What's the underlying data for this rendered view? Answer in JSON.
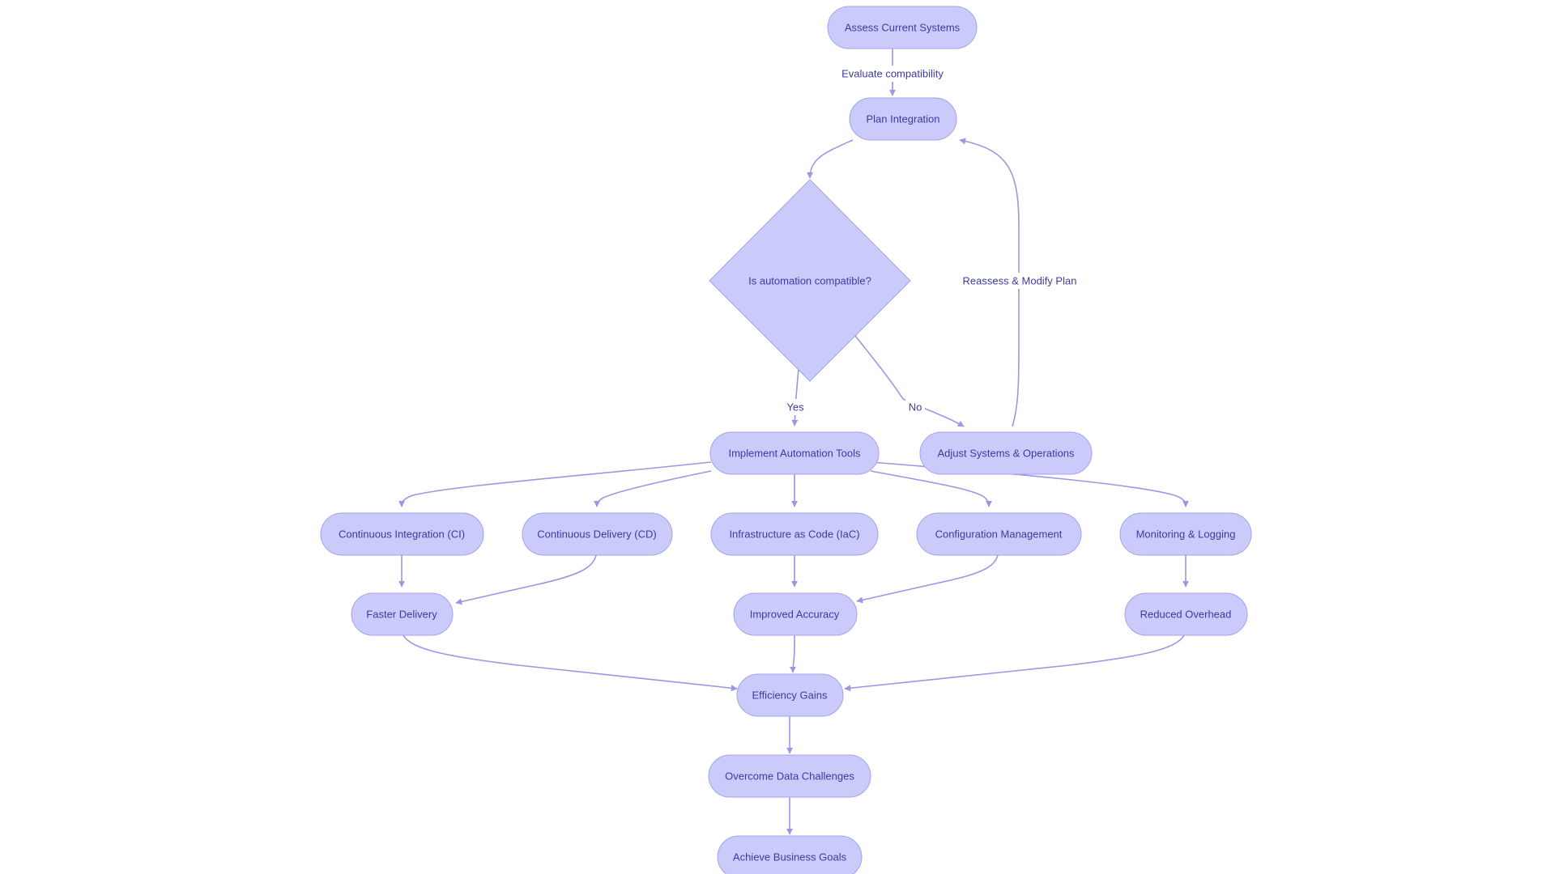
{
  "diagram": {
    "type": "flowchart",
    "colors": {
      "node_fill": "#cbcbfb",
      "node_stroke": "#a3a3ea",
      "text": "#3b3b9f",
      "edge": "#9898e3"
    },
    "nodes": {
      "assess": "Assess Current Systems",
      "plan": "Plan Integration",
      "decision": "Is automation compatible?",
      "implement": "Implement Automation Tools",
      "adjust": "Adjust Systems & Operations",
      "ci": "Continuous Integration (CI)",
      "cd": "Continuous Delivery (CD)",
      "iac": "Infrastructure as Code (IaC)",
      "config": "Configuration Management",
      "monitoring": "Monitoring & Logging",
      "faster": "Faster Delivery",
      "accuracy": "Improved Accuracy",
      "overhead": "Reduced Overhead",
      "efficiency": "Efficiency Gains",
      "overcome": "Overcome Data Challenges",
      "achieve": "Achieve Business Goals"
    },
    "edges": [
      {
        "from": "assess",
        "to": "plan",
        "label": "Evaluate compatibility"
      },
      {
        "from": "plan",
        "to": "decision",
        "label": ""
      },
      {
        "from": "decision",
        "to": "implement",
        "label": "Yes"
      },
      {
        "from": "decision",
        "to": "adjust",
        "label": "No"
      },
      {
        "from": "adjust",
        "to": "plan",
        "label": "Reassess & Modify Plan"
      },
      {
        "from": "implement",
        "to": "ci",
        "label": ""
      },
      {
        "from": "implement",
        "to": "cd",
        "label": ""
      },
      {
        "from": "implement",
        "to": "iac",
        "label": ""
      },
      {
        "from": "implement",
        "to": "config",
        "label": ""
      },
      {
        "from": "implement",
        "to": "monitoring",
        "label": ""
      },
      {
        "from": "ci",
        "to": "faster",
        "label": ""
      },
      {
        "from": "cd",
        "to": "faster",
        "label": ""
      },
      {
        "from": "iac",
        "to": "accuracy",
        "label": ""
      },
      {
        "from": "config",
        "to": "accuracy",
        "label": ""
      },
      {
        "from": "monitoring",
        "to": "overhead",
        "label": ""
      },
      {
        "from": "faster",
        "to": "efficiency",
        "label": ""
      },
      {
        "from": "accuracy",
        "to": "efficiency",
        "label": ""
      },
      {
        "from": "overhead",
        "to": "efficiency",
        "label": ""
      },
      {
        "from": "efficiency",
        "to": "overcome",
        "label": ""
      },
      {
        "from": "overcome",
        "to": "achieve",
        "label": ""
      }
    ],
    "edge_labels": {
      "evaluate": "Evaluate compatibility",
      "yes": "Yes",
      "no": "No",
      "reassess": "Reassess & Modify Plan"
    }
  }
}
